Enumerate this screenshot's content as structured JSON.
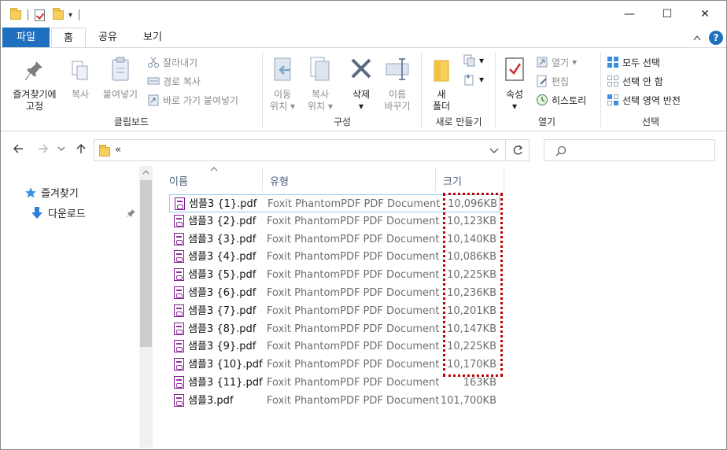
{
  "title_bar": {
    "dropdown_glyph": "▾",
    "controls": {
      "minimize": "—",
      "maximize": "☐",
      "close": "✕"
    }
  },
  "tabs": [
    {
      "label": "파일"
    },
    {
      "label": "홈"
    },
    {
      "label": "공유"
    },
    {
      "label": "보기"
    }
  ],
  "ribbon": {
    "clipboard": {
      "pin_label": "즐겨찾기에",
      "pin_label2": "고정",
      "copy_label": "복사",
      "paste_label": "붙여넣기",
      "cut_label": "잘라내기",
      "copy_path_label": "경로 복사",
      "paste_shortcut_label": "바로 가기 붙여넣기",
      "group_label": "클립보드"
    },
    "organize": {
      "move_label": "이동",
      "move_label2": "위치",
      "copyto_label": "복사",
      "copyto_label2": "위치",
      "delete_label": "삭제",
      "rename_label": "이름",
      "rename_label2": "바꾸기",
      "group_label": "구성"
    },
    "new": {
      "new_folder_label": "새",
      "new_folder_label2": "폴더",
      "group_label": "새로 만들기"
    },
    "open": {
      "properties_label": "속성",
      "open_label": "열기",
      "edit_label": "편집",
      "history_label": "히스토리",
      "group_label": "열기"
    },
    "select": {
      "select_all_label": "모두 선택",
      "select_none_label": "선택 안 함",
      "invert_label": "선택 영역 반전",
      "group_label": "선택"
    }
  },
  "address": {
    "crumb": "«"
  },
  "navigation": {
    "favorites_label": "즐겨찾기",
    "downloads_label": "다운로드"
  },
  "columns": {
    "name": "이름",
    "type": "유형",
    "size": "크기"
  },
  "files": [
    {
      "name": "샘플3 {1}.pdf",
      "type": "Foxit PhantomPDF PDF Document",
      "size": "10,096KB"
    },
    {
      "name": "샘플3 {2}.pdf",
      "type": "Foxit PhantomPDF PDF Document",
      "size": "10,123KB"
    },
    {
      "name": "샘플3 {3}.pdf",
      "type": "Foxit PhantomPDF PDF Document",
      "size": "10,140KB"
    },
    {
      "name": "샘플3 {4}.pdf",
      "type": "Foxit PhantomPDF PDF Document",
      "size": "10,086KB"
    },
    {
      "name": "샘플3 {5}.pdf",
      "type": "Foxit PhantomPDF PDF Document",
      "size": "10,225KB"
    },
    {
      "name": "샘플3 {6}.pdf",
      "type": "Foxit PhantomPDF PDF Document",
      "size": "10,236KB"
    },
    {
      "name": "샘플3 {7}.pdf",
      "type": "Foxit PhantomPDF PDF Document",
      "size": "10,201KB"
    },
    {
      "name": "샘플3 {8}.pdf",
      "type": "Foxit PhantomPDF PDF Document",
      "size": "10,147KB"
    },
    {
      "name": "샘플3 {9}.pdf",
      "type": "Foxit PhantomPDF PDF Document",
      "size": "10,225KB"
    },
    {
      "name": "샘플3 {10}.pdf",
      "type": "Foxit PhantomPDF PDF Document",
      "size": "10,170KB"
    },
    {
      "name": "샘플3 {11}.pdf",
      "type": "Foxit PhantomPDF PDF Document",
      "size": "163KB"
    },
    {
      "name": "샘플3.pdf",
      "type": "Foxit PhantomPDF PDF Document",
      "size": "101,700KB"
    }
  ],
  "colors": {
    "accent": "#1f6fbf",
    "highlight_border": "#c00000",
    "selection_border": "#99c9ef"
  }
}
